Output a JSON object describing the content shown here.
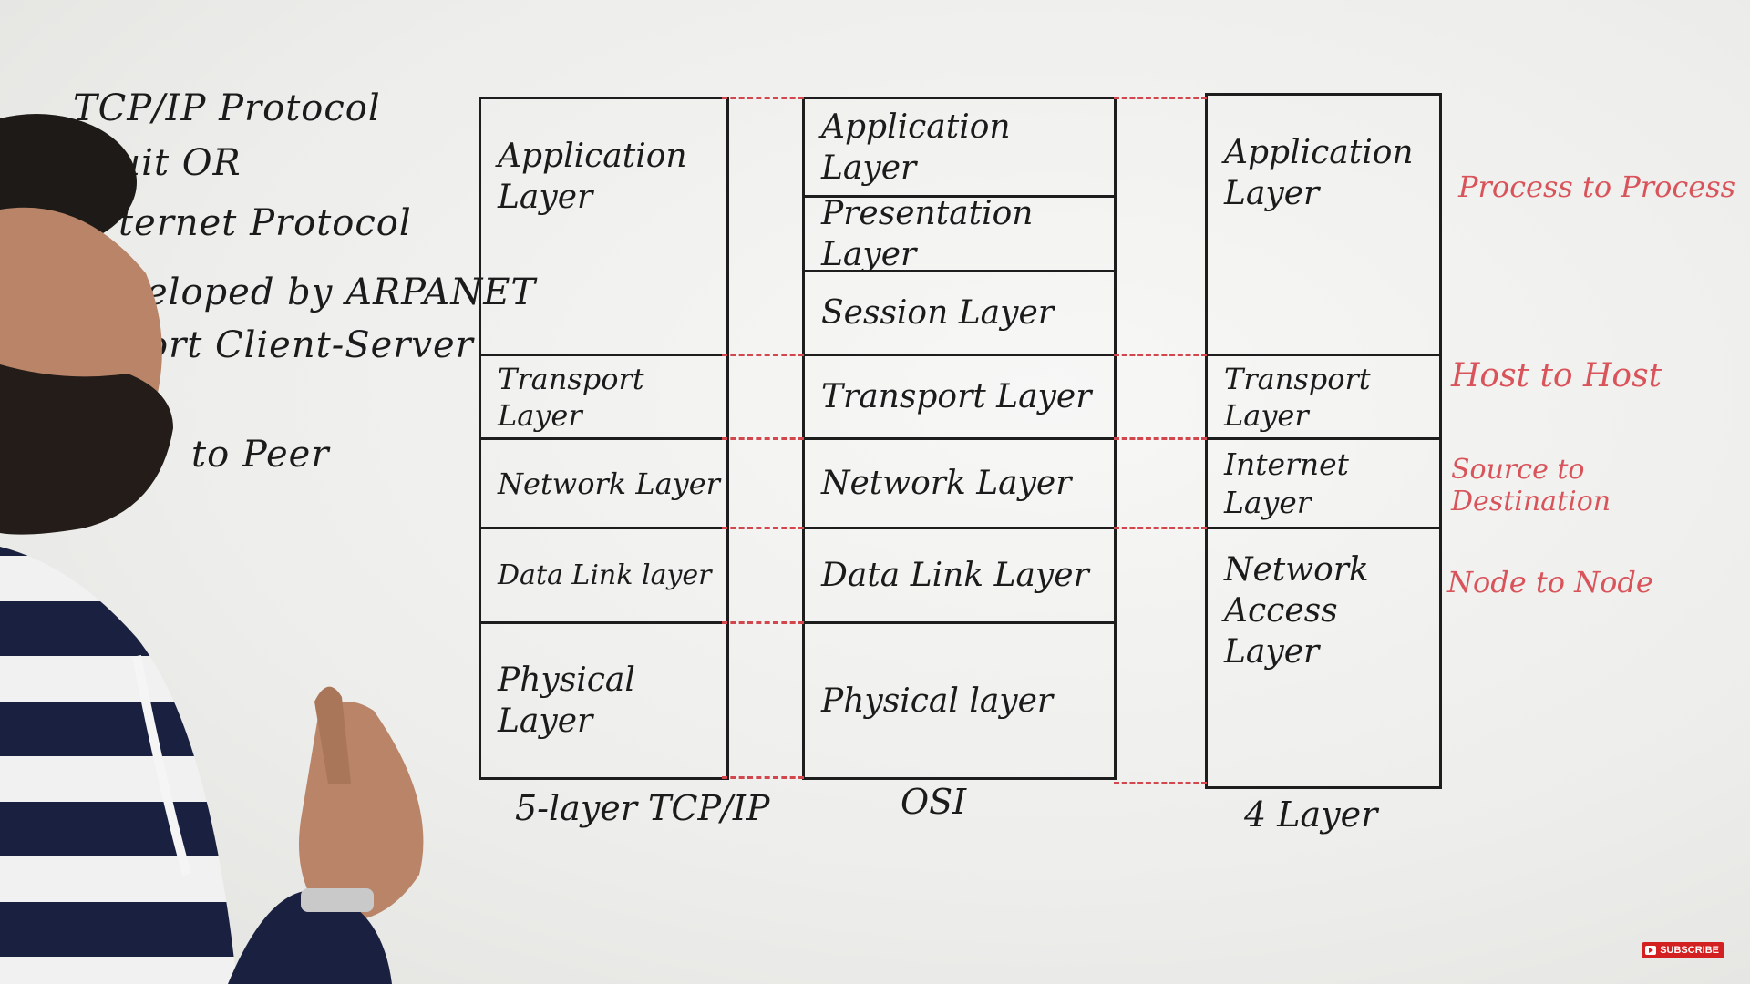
{
  "notes": [
    "TCP/IP Protocol",
    "Suit   OR",
    "ternet Protocol",
    "eloped by ARPANET",
    "ort  Client-Server",
    "to Peer"
  ],
  "columns": [
    {
      "label": "5-layer TCP/IP",
      "layers": [
        "Application\nLayer",
        "Transport Layer",
        "Network Layer",
        "Data Link layer",
        "Physical\nLayer"
      ]
    },
    {
      "label": "OSI",
      "layers": [
        "Application Layer",
        "Presentation Layer",
        "Session Layer",
        "Transport Layer",
        "Network Layer",
        "Data Link Layer",
        "Physical layer"
      ]
    },
    {
      "label": "4 Layer",
      "layers": [
        "Application\nLayer",
        "Transport Layer",
        "Internet Layer",
        "Network\nAccess\nLayer"
      ]
    }
  ],
  "delivery": [
    "Process to Process",
    "Host to Host",
    "Source to Destination",
    "Node to Node"
  ],
  "colors": {
    "marker_black": "#1d1d1d",
    "marker_red": "#d9545a",
    "subscribe": "#d32020"
  },
  "subscribe_label": "SUBSCRIBE"
}
